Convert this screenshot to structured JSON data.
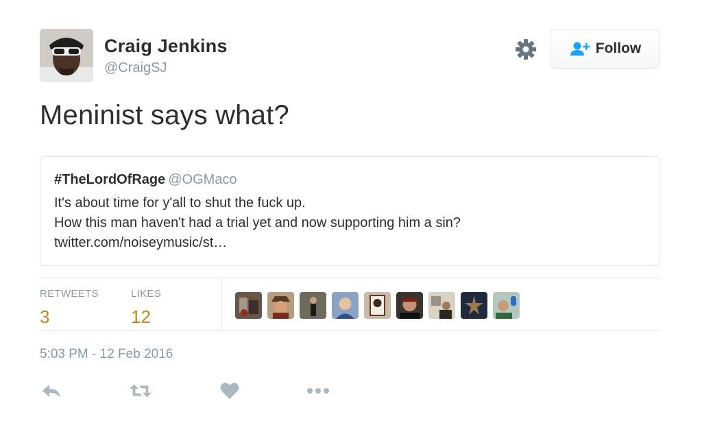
{
  "author": {
    "display_name": "Craig Jenkins",
    "handle": "@CraigSJ"
  },
  "follow_button": {
    "label": "Follow"
  },
  "tweet": {
    "text": "Meninist says what?"
  },
  "quoted_tweet": {
    "display_name": "#TheLordOfRage",
    "handle": "@OGMaco",
    "lines": [
      "It's about time for y'all to shut the fuck up.",
      "How this man haven't had a trial yet and now supporting him a sin?",
      "twitter.com/noiseymusic/st…"
    ]
  },
  "stats": {
    "retweets_label": "RETWEETS",
    "retweets_count": "3",
    "likes_label": "LIKES",
    "likes_count": "12"
  },
  "likers": [
    "liker-avatar-1",
    "liker-avatar-2",
    "liker-avatar-3",
    "liker-avatar-4",
    "liker-avatar-5",
    "liker-avatar-6",
    "liker-avatar-7",
    "liker-avatar-8",
    "liker-avatar-9"
  ],
  "timestamp": "5:03 PM - 12 Feb 2016",
  "colors": {
    "text": "#292f33",
    "secondary": "#8899a6",
    "stat_number": "#c0881f",
    "border": "#e1e8ed",
    "follow_icon": "#1da1f2",
    "action_icon": "#aab8c2"
  },
  "actions": [
    "reply-icon",
    "retweet-icon",
    "like-icon",
    "more-icon"
  ]
}
